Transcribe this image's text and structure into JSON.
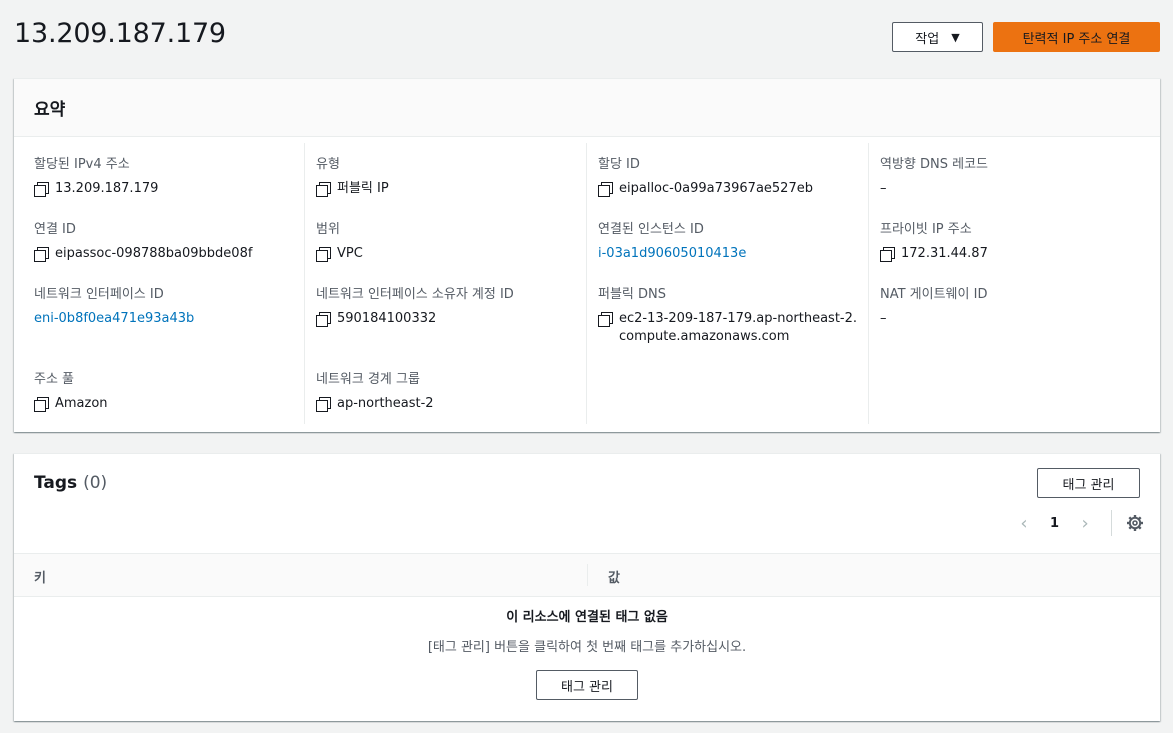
{
  "header": {
    "title": "13.209.187.179",
    "actions_label": "작업",
    "associate_label": "탄력적 IP 주소 연결"
  },
  "summary": {
    "title": "요약",
    "columns": [
      [
        {
          "label": "할당된 IPv4 주소",
          "value": "13.209.187.179",
          "copy": true,
          "link": false
        },
        {
          "label": "연결 ID",
          "value": "eipassoc-098788ba09bbde08f",
          "copy": true,
          "link": false
        },
        {
          "label": "네트워크 인터페이스 ID",
          "value": "eni-0b8f0ea471e93a43b",
          "copy": false,
          "link": true
        },
        {
          "label": "주소 풀",
          "value": "Amazon",
          "copy": true,
          "link": false
        }
      ],
      [
        {
          "label": "유형",
          "value": "퍼블릭 IP",
          "copy": true,
          "link": false
        },
        {
          "label": "범위",
          "value": "VPC",
          "copy": true,
          "link": false
        },
        {
          "label": "네트워크 인터페이스 소유자 계정 ID",
          "value": "590184100332",
          "copy": true,
          "link": false
        },
        {
          "label": "네트워크 경계 그룹",
          "value": "ap-northeast-2",
          "copy": true,
          "link": false
        }
      ],
      [
        {
          "label": "할당 ID",
          "value": "eipalloc-0a99a73967ae527eb",
          "copy": true,
          "link": false
        },
        {
          "label": "연결된 인스턴스 ID",
          "value": "i-03a1d90605010413e",
          "copy": false,
          "link": true
        },
        {
          "label": "퍼블릭 DNS",
          "value": "ec2-13-209-187-179.ap-northeast-2.compute.amazonaws.com",
          "copy": true,
          "link": false
        }
      ],
      [
        {
          "label": "역방향 DNS 레코드",
          "value": "–",
          "copy": false,
          "link": false
        },
        {
          "label": "프라이빗 IP 주소",
          "value": "172.31.44.87",
          "copy": true,
          "link": false
        },
        {
          "label": "NAT 게이트웨이 ID",
          "value": "–",
          "copy": false,
          "link": false
        }
      ]
    ]
  },
  "tags": {
    "title": "Tags",
    "count": "(0)",
    "manage_label": "태그 관리",
    "page": "1",
    "columns": [
      "키",
      "값"
    ],
    "empty_title": "이 리소스에 연결된 태그 없음",
    "empty_desc": "[태그 관리] 버튼을 클릭하여 첫 번째 태그를 추가하십시오.",
    "empty_button": "태그 관리"
  }
}
